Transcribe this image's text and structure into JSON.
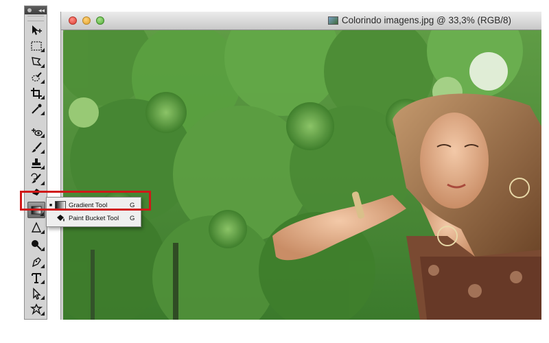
{
  "document": {
    "title": "Colorindo imagens.jpg @ 33,3% (RGB/8)"
  },
  "tools_panel": {
    "tools": [
      {
        "name": "move-tool"
      },
      {
        "name": "marquee-tool"
      },
      {
        "name": "lasso-tool"
      },
      {
        "name": "quick-selection-tool"
      },
      {
        "name": "crop-tool"
      },
      {
        "name": "eyedropper-tool"
      },
      {
        "name": "spot-healing-tool"
      },
      {
        "name": "brush-tool"
      },
      {
        "name": "clone-stamp-tool"
      },
      {
        "name": "history-brush-tool"
      },
      {
        "name": "eraser-tool"
      },
      {
        "name": "gradient-tool"
      },
      {
        "name": "blur-tool"
      },
      {
        "name": "dodge-tool"
      },
      {
        "name": "pen-tool"
      },
      {
        "name": "type-tool"
      },
      {
        "name": "path-selection-tool"
      },
      {
        "name": "custom-shape-tool"
      }
    ]
  },
  "flyout": {
    "items": [
      {
        "label": "Gradient Tool",
        "shortcut": "G",
        "selected": true
      },
      {
        "label": "Paint Bucket Tool",
        "shortcut": "G",
        "selected": false
      }
    ]
  },
  "colors": {
    "highlight": "#d01818",
    "foliage": "#4a8a32"
  }
}
